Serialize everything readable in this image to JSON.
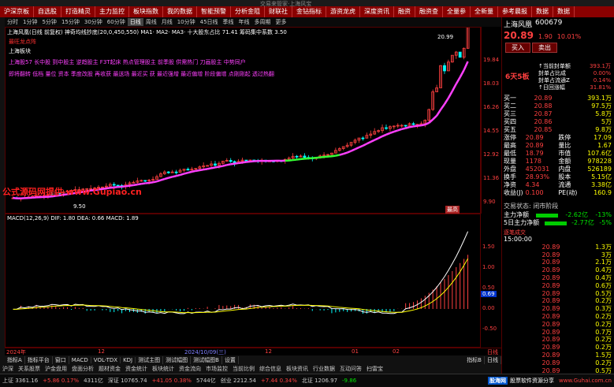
{
  "window": {
    "title": "交易来管家·上海风宝"
  },
  "menu": [
    "沪深京板",
    "自选股",
    "打造精灵",
    "主力监控",
    "板块指数",
    "我的数据",
    "智能预警",
    "分析金阻",
    "财联社",
    "金钻指标",
    "游资龙虎",
    "深度资讯",
    "融资",
    "融资查",
    "全量参",
    "全新量",
    "参考晨报",
    "数据",
    "数据"
  ],
  "period": {
    "items": [
      "分时",
      "1分钟",
      "5分钟",
      "15分钟",
      "30分钟",
      "60分钟",
      "日线",
      "周线",
      "月线",
      "10分钟",
      "45日线",
      "季线",
      "年线",
      "多周期",
      "更多"
    ],
    "active": "日线"
  },
  "stock": {
    "name": "上海风凰",
    "code": "600679",
    "price": "20.89",
    "change": "1.90",
    "pct": "10.01%"
  },
  "main_chart": {
    "legend": "上海风凰(日线 前复权)  神奇均线抄底(20,0,450,550) MA1· MA2· MA3·  十大股东占比 71.41  筹码集中系数 3.50",
    "labels": [
      "最旺龙点阵",
      "上海板块",
      "上海股57 长中股 到中股主 逆趋股主 F3T起床 热点管理股主 前季股 供需热门 刀画股主 中势同户",
      "即将翻转 低档 量位 资本 季度改股 再收获 最送场 最近买 获 最近强增 最近偏增 阶段偏增 点刚刚起 透过热翻"
    ],
    "watermark": "公式源码网提供 www.Gupiao.cn",
    "markers": {
      "top": "20.99",
      "low": "9.50"
    },
    "right_label": "最高"
  },
  "y_ticks": [
    "19.84",
    "18.03",
    "16.26",
    "14.55",
    "12.92",
    "11.36",
    "9.90"
  ],
  "macd": {
    "legend": "MACD(12,26,9)  DIF: 1.80  DEA: 0.66  MACD: 1.89",
    "y_ticks": [
      "1.50",
      "1.00",
      "0.50",
      "0.00",
      "-0.50"
    ],
    "marker_value": "0.69"
  },
  "xaxis": {
    "labels": [
      "2024年",
      "12",
      "2024/10/09(三)",
      "12",
      "01",
      "02",
      "日线"
    ]
  },
  "tabs": [
    "指标A",
    "指标平台",
    "窗口",
    "MACD",
    "VOL-TDX",
    "KDJ",
    "测试主图",
    "测试幅图",
    "测试幅图B",
    "设置"
  ],
  "tabs_right": [
    "指标B",
    "日线"
  ],
  "bottomstrip": [
    "沪深",
    "关系股票",
    "沪金盘用",
    "盘面分析",
    "题材资金",
    "资金统计",
    "板块统计",
    "资金流向",
    "市场监控",
    "当前比例",
    "综合信息",
    "板块资讯",
    "行业数据",
    "互动问答",
    "扫雷宝"
  ],
  "statusbar": {
    "items": [
      "上证 3361.16",
      "+5.86 0.17%",
      "4311亿",
      "深证 10765.74",
      "+41.05 0.38%",
      "5744亿",
      "创业 2212.54",
      "+7.44 0.34%",
      "北证 1206.97",
      "-9.86"
    ],
    "brand": "股海网",
    "brand_sub": "股票软件资源分享",
    "brand_url": "www.Guhai.com.cn"
  },
  "panel": {
    "badge": "6天5板",
    "buy_btn": "买入",
    "sell_btn": "卖出",
    "info": [
      {
        "label": "↑当前封单额",
        "value": "393.1万"
      },
      {
        "label": "封单占比成",
        "value": "0.00%"
      },
      {
        "label": "封单占流通Z",
        "value": "0.14%"
      },
      {
        "label": "↑日回涨幅",
        "value": "31.81%"
      }
    ],
    "asks": [
      {
        "label": "卖五",
        "price": "",
        "vol": ""
      },
      {
        "label": "卖四",
        "price": "",
        "vol": ""
      },
      {
        "label": "卖三",
        "price": "",
        "vol": ""
      },
      {
        "label": "卖二",
        "price": "",
        "vol": ""
      },
      {
        "label": "卖一",
        "price": "",
        "vol": ""
      }
    ],
    "bids": [
      {
        "label": "买一",
        "price": "20.89",
        "vol": "393.1万"
      },
      {
        "label": "买二",
        "price": "20.88",
        "vol": "97.5万"
      },
      {
        "label": "买三",
        "price": "20.87",
        "vol": "5.8万"
      },
      {
        "label": "买四",
        "price": "20.86",
        "vol": "5万"
      },
      {
        "label": "买五",
        "price": "20.85",
        "vol": "9.8万"
      }
    ],
    "stats": [
      {
        "l1": "涨停",
        "v1": "20.89",
        "l2": "跌停",
        "v2": "17.09"
      },
      {
        "l1": "最高",
        "v1": "20.89",
        "l2": "量比",
        "v2": "1.67"
      },
      {
        "l1": "最低",
        "v1": "18.79",
        "l2": "市值",
        "v2": "107.6亿"
      },
      {
        "l1": "现量",
        "v1": "1178",
        "l2": "金额",
        "v2": "978228"
      },
      {
        "l1": "外盘",
        "v1": "452031",
        "l2": "内盘",
        "v2": "526189"
      },
      {
        "l1": "换手",
        "v1": "28.93%",
        "l2": "股本",
        "v2": "5.15亿"
      },
      {
        "l1": "净资",
        "v1": "4.34",
        "l2": "流通",
        "v2": "3.38亿"
      },
      {
        "l1": "收益(J)",
        "v1": "0.100",
        "l2": "PE(动)",
        "v2": "160.9"
      }
    ],
    "trade_state": "交易状态: 闭市阶段",
    "trade_time": "15:00:00",
    "flow": [
      {
        "label": "主力净额",
        "value": "-2.62亿",
        "pct": "-13%"
      },
      {
        "label": "5日主力净额",
        "value": "-2.77亿",
        "pct": "-5%"
      }
    ],
    "ticks_title": "逐笔成交",
    "ticks": [
      {
        "time": "15:00:00",
        "price": "",
        "vol": ""
      },
      {
        "time": "",
        "price": "20.89",
        "vol": "1.3万"
      },
      {
        "time": "",
        "price": "20.89",
        "vol": "3万"
      },
      {
        "time": "",
        "price": "20.89",
        "vol": "2.1万"
      },
      {
        "time": "",
        "price": "20.89",
        "vol": "0.4万"
      },
      {
        "time": "",
        "price": "20.89",
        "vol": "0.4万"
      },
      {
        "time": "",
        "price": "20.89",
        "vol": "0.6万"
      },
      {
        "time": "",
        "price": "20.89",
        "vol": "0.5万"
      },
      {
        "time": "",
        "price": "20.89",
        "vol": "0.2万"
      },
      {
        "time": "",
        "price": "20.89",
        "vol": "0.3万"
      },
      {
        "time": "",
        "price": "20.89",
        "vol": "0.2万"
      },
      {
        "time": "",
        "price": "20.89",
        "vol": "0.2万"
      },
      {
        "time": "",
        "price": "20.89",
        "vol": "0.7万"
      },
      {
        "time": "",
        "price": "20.89",
        "vol": "0.2万"
      },
      {
        "time": "",
        "price": "20.89",
        "vol": "0.2万"
      },
      {
        "time": "",
        "price": "20.89",
        "vol": "1.5万"
      },
      {
        "time": "",
        "price": "20.89",
        "vol": "0.2万"
      },
      {
        "time": "",
        "price": "20.89",
        "vol": "0.5万"
      },
      {
        "time": "",
        "price": "20.89",
        "vol": "0.1万"
      },
      {
        "time": "",
        "price": "20.89",
        "vol": "0.2万"
      },
      {
        "time": "",
        "price": "20.89",
        "vol": "0.2万"
      }
    ]
  },
  "colors": {
    "up": "#ff4040",
    "down": "#00ffff",
    "ma_pink": "#ff40ff",
    "ma_green": "#33ff33",
    "menu_bg": "#8a0000"
  }
}
